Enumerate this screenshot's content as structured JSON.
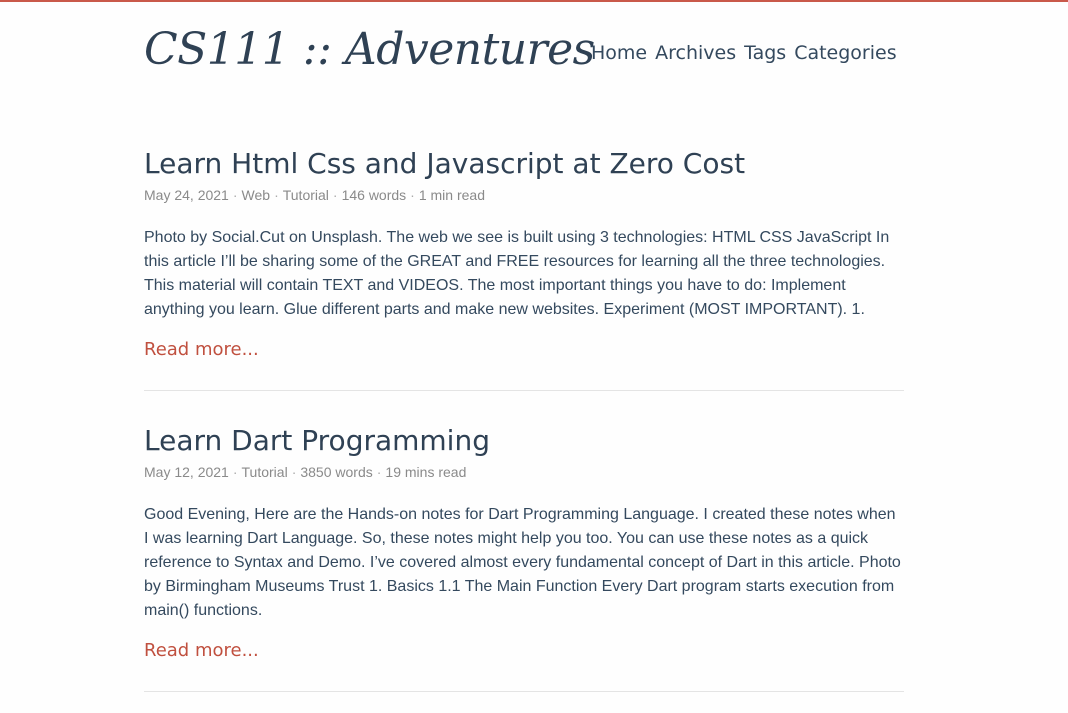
{
  "site": {
    "title": "CS111 :: Adventures",
    "accent_color": "#c9594a"
  },
  "nav": {
    "items": [
      {
        "label": "Home"
      },
      {
        "label": "Archives"
      },
      {
        "label": "Tags"
      },
      {
        "label": "Categories"
      }
    ]
  },
  "posts": [
    {
      "title": "Learn Html Css and Javascript at Zero Cost",
      "date": "May 24, 2021",
      "category": "Web",
      "tag": "Tutorial",
      "words": "146 words",
      "read_time": "1 min read",
      "summary": "Photo by Social.Cut on Unsplash. The web we see is built using 3 technologies: HTML CSS JavaScript In this article I’ll be sharing some of the GREAT and FREE resources for learning all the three technologies. This material will contain TEXT and VIDEOS. The most important things you have to do: Implement anything you learn. Glue different parts and make new websites. Experiment (MOST IMPORTANT). 1.",
      "read_more": "Read more..."
    },
    {
      "title": "Learn Dart Programming",
      "date": "May 12, 2021",
      "tag": "Tutorial",
      "words": "3850 words",
      "read_time": "19 mins read",
      "summary": "Good Evening, Here are the Hands-on notes for Dart Programming Language. I created these notes when I was learning Dart Language. So, these notes might help you too. You can use these notes as a quick reference to Syntax and Demo. I’ve covered almost every fundamental concept of Dart in this article. Photo by Birmingham Museums Trust 1. Basics 1.1 The Main Function Every Dart program starts execution from main() functions.",
      "read_more": "Read more..."
    }
  ]
}
